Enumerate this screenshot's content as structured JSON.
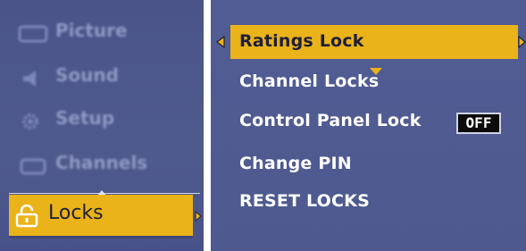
{
  "left_menu": {
    "items": [
      {
        "label": "Picture",
        "icon": "picture-icon"
      },
      {
        "label": "Sound",
        "icon": "speaker-icon"
      },
      {
        "label": "Setup",
        "icon": "gear-icon"
      },
      {
        "label": "Channels",
        "icon": "tv-icon"
      },
      {
        "label": "Locks",
        "icon": "padlock-icon",
        "selected": true
      }
    ]
  },
  "right_menu": {
    "items": [
      {
        "label": "Ratings Lock",
        "selected": true
      },
      {
        "label": "Channel Locks"
      },
      {
        "label": "Control Panel Lock",
        "value": "OFF"
      },
      {
        "label": "Change PIN"
      },
      {
        "label": "RESET LOCKS"
      }
    ]
  },
  "colors": {
    "panel_background": "#4f5b8d",
    "highlight": "#eab319",
    "text": "#ffffff",
    "dim_text": "#8f99c4",
    "value_box_background": "#0b0b0b"
  }
}
